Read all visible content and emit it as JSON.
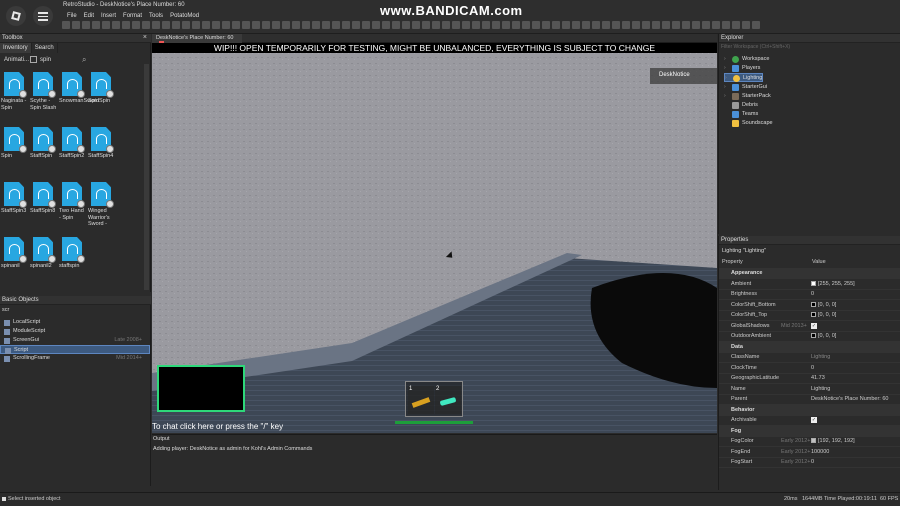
{
  "app": {
    "title": "RetroStudio - DeskNotice's Place Number: 60"
  },
  "menu": [
    "File",
    "Edit",
    "Insert",
    "Format",
    "Tools",
    "PotatoMod"
  ],
  "watermark": "www.BANDICAM.com",
  "toolbox": {
    "header": "Toolbox",
    "tabs": [
      "Inventory",
      "Search"
    ],
    "filter": "Animati...",
    "query": "spin",
    "items": [
      {
        "name": "Naginata - Spin"
      },
      {
        "name": "Scythe - Spin Slash"
      },
      {
        "name": "SnowmanSwordSpin"
      },
      {
        "name": "Spin"
      },
      {
        "name": ""
      },
      {
        "name": "Spin"
      },
      {
        "name": "StaffSpin"
      },
      {
        "name": "StaffSpin2"
      },
      {
        "name": "StaffSpin4"
      },
      {
        "name": ""
      },
      {
        "name": "StaffSpin3"
      },
      {
        "name": "StaffSpin8"
      },
      {
        "name": "Two Hand - Spin"
      },
      {
        "name": "Winged Warrior's Sword -"
      },
      {
        "name": ""
      },
      {
        "name": "spinanil"
      },
      {
        "name": "spinanil2"
      },
      {
        "name": "staffspin"
      }
    ]
  },
  "basic_objects": {
    "header": "Basic Objects",
    "query": "scr",
    "items": [
      {
        "name": "LocalScript",
        "ver": ""
      },
      {
        "name": "ModuleScript",
        "ver": ""
      },
      {
        "name": "ScreenGui",
        "ver": "Late 2008+"
      },
      {
        "name": "Script",
        "ver": ""
      },
      {
        "name": "ScrollingFrame",
        "ver": "Mid 2014+"
      }
    ]
  },
  "doc_tab": "DeskNotice's Place Number: 60",
  "viewport": {
    "banner": "WIP!!! OPEN TEMPORARILY FOR TESTING, MIGHT BE UNBALANCED, EVERYTHING IS SUBJECT TO CHANGE",
    "player_tag": "DeskNotice",
    "chat_hint": "To chat click here or press the \"/\" key",
    "hotbar": [
      "1",
      "2"
    ]
  },
  "output": {
    "header": "Output",
    "line": "Adding player: DeskNotice as admin for Kohl's Admin Commands"
  },
  "explorer": {
    "header": "Explorer",
    "filter_placeholder": "Filter Workspace (Ctrl+Shift+X)",
    "items": [
      {
        "name": "Workspace",
        "color": "#3fa34d"
      },
      {
        "name": "Players",
        "color": "#4a90d9"
      },
      {
        "name": "Lighting",
        "color": "#f0c040"
      },
      {
        "name": "StarterGui",
        "color": "#4a90d9"
      },
      {
        "name": "StarterPack",
        "color": "#7a6b5a"
      },
      {
        "name": "Debris",
        "color": "#999999"
      },
      {
        "name": "Teams",
        "color": "#4a90d9"
      },
      {
        "name": "Soundscape",
        "color": "#f0c040"
      }
    ]
  },
  "properties": {
    "header": "Properties",
    "subtitle": "Lighting \"Lighting\"",
    "col_property": "Property",
    "col_value": "Value",
    "rows": [
      {
        "cat": "Appearance"
      },
      {
        "name": "Ambient",
        "value": "[255, 255, 255]",
        "swatch": "#ffffff"
      },
      {
        "name": "Brightness",
        "value": "0"
      },
      {
        "name": "ColorShift_Bottom",
        "value": "[0, 0, 0]",
        "swatch": "#000000"
      },
      {
        "name": "ColorShift_Top",
        "value": "[0, 0, 0]",
        "swatch": "#000000"
      },
      {
        "name": "GlobalShadows",
        "ver": "Mid 2013+",
        "check": true,
        "value": ""
      },
      {
        "name": "OutdoorAmbient",
        "value": "[0, 0, 0]",
        "swatch": "#000000"
      },
      {
        "cat": "Data"
      },
      {
        "name": "ClassName",
        "value": "Lighting"
      },
      {
        "name": "ClockTime",
        "value": "0"
      },
      {
        "name": "GeographicLatitude",
        "value": "41.73"
      },
      {
        "name": "Name",
        "value": "Lighting"
      },
      {
        "name": "Parent",
        "value": "DeskNotice's Place Number: 60"
      },
      {
        "cat": "Behavior"
      },
      {
        "name": "Archivable",
        "check": true,
        "value": ""
      },
      {
        "cat": "Fog"
      },
      {
        "name": "FogColor",
        "ver": "Early 2012+",
        "value": "[192, 192, 192]",
        "swatch": "#c0c0c0"
      },
      {
        "name": "FogEnd",
        "ver": "Early 2012+",
        "value": "100000"
      },
      {
        "name": "FogStart",
        "ver": "Early 2012+",
        "value": "0"
      }
    ]
  },
  "status": {
    "left": "Select inserted object",
    "ping": "20ms",
    "memory": "1644MB",
    "time_played": "Time Played:00:19:11",
    "fps": "60 FPS"
  }
}
